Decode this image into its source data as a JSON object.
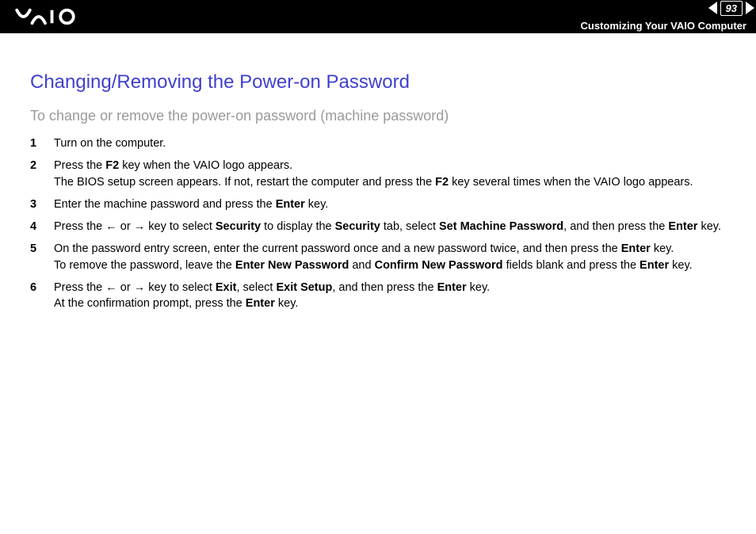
{
  "header": {
    "page_number": "93",
    "breadcrumb": "Customizing Your VAIO Computer"
  },
  "content": {
    "title": "Changing/Removing the Power-on Password",
    "subtitle": "To change or remove the power-on password (machine password)",
    "steps": [
      {
        "num": "1",
        "text_parts": [
          {
            "t": "Turn on the computer."
          }
        ]
      },
      {
        "num": "2",
        "text_parts": [
          {
            "t": "Press the "
          },
          {
            "t": "F2",
            "b": true
          },
          {
            "t": " key when the VAIO logo appears."
          },
          {
            "br": true
          },
          {
            "t": "The BIOS setup screen appears. If not, restart the computer and press the "
          },
          {
            "t": "F2",
            "b": true
          },
          {
            "t": " key several times when the VAIO logo appears."
          }
        ]
      },
      {
        "num": "3",
        "text_parts": [
          {
            "t": "Enter the machine password and press the "
          },
          {
            "t": "Enter",
            "b": true
          },
          {
            "t": " key."
          }
        ]
      },
      {
        "num": "4",
        "text_parts": [
          {
            "t": "Press the "
          },
          {
            "arrow": "left"
          },
          {
            "t": " or "
          },
          {
            "arrow": "right"
          },
          {
            "t": " key to select "
          },
          {
            "t": "Security",
            "b": true
          },
          {
            "t": " to display the "
          },
          {
            "t": "Security",
            "b": true
          },
          {
            "t": " tab, select "
          },
          {
            "t": "Set Machine Password",
            "b": true
          },
          {
            "t": ", and then press the "
          },
          {
            "t": "Enter",
            "b": true
          },
          {
            "t": " key."
          }
        ]
      },
      {
        "num": "5",
        "text_parts": [
          {
            "t": "On the password entry screen, enter the current password once and a new password twice, and then press the "
          },
          {
            "t": "Enter",
            "b": true
          },
          {
            "t": " key."
          },
          {
            "br": true
          },
          {
            "t": "To remove the password, leave the "
          },
          {
            "t": "Enter New Password",
            "b": true
          },
          {
            "t": " and "
          },
          {
            "t": "Confirm New Password",
            "b": true
          },
          {
            "t": " fields blank and press the "
          },
          {
            "t": "Enter",
            "b": true
          },
          {
            "t": " key."
          }
        ]
      },
      {
        "num": "6",
        "text_parts": [
          {
            "t": "Press the "
          },
          {
            "arrow": "left"
          },
          {
            "t": " or "
          },
          {
            "arrow": "right"
          },
          {
            "t": " key to select "
          },
          {
            "t": "Exit",
            "b": true
          },
          {
            "t": ", select "
          },
          {
            "t": "Exit Setup",
            "b": true
          },
          {
            "t": ", and then press the "
          },
          {
            "t": "Enter",
            "b": true
          },
          {
            "t": " key."
          },
          {
            "br": true
          },
          {
            "t": "At the confirmation prompt, press the "
          },
          {
            "t": "Enter",
            "b": true
          },
          {
            "t": " key."
          }
        ]
      }
    ]
  }
}
